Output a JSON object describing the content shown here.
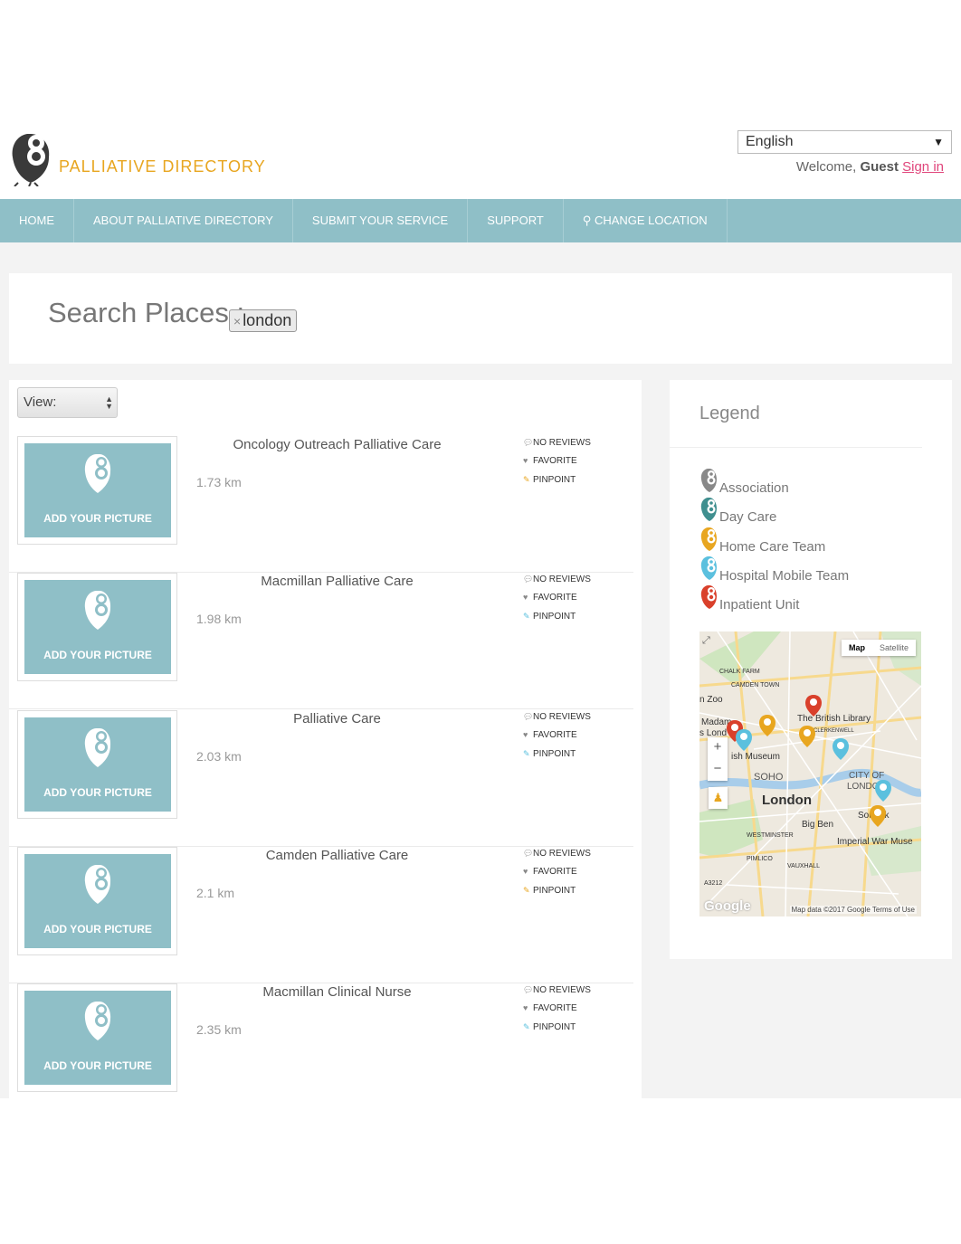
{
  "header": {
    "logo_text": "PALLIATIVE DIRECTORY",
    "language": "English",
    "welcome_prefix": "Welcome,",
    "welcome_user": "Guest",
    "sign_in": "Sign in"
  },
  "nav": {
    "items": [
      "HOME",
      "ABOUT PALLIATIVE DIRECTORY",
      "SUBMIT YOUR SERVICE",
      "SUPPORT",
      "CHANGE LOCATION"
    ]
  },
  "search": {
    "title": "Search Places :",
    "tag_remove": "×",
    "tag": "london"
  },
  "results": {
    "view_label": "View:",
    "add_picture": "ADD YOUR PICTURE",
    "meta_reviews": "NO REVIEWS",
    "meta_favorite": "FAVORITE",
    "meta_pinpoint": "PINPOINT",
    "items": [
      {
        "title": "Oncology Outreach Palliative Care",
        "distance": "1.73 km",
        "pin_color": "#e8a620"
      },
      {
        "title": "Macmillan Palliative Care",
        "distance": "1.98 km",
        "pin_color": "#5bc0de"
      },
      {
        "title": "Palliative Care",
        "distance": "2.03 km",
        "pin_color": "#5bc0de"
      },
      {
        "title": "Camden Palliative Care",
        "distance": "2.1 km",
        "pin_color": "#e8a620"
      },
      {
        "title": "Macmillan Clinical Nurse",
        "distance": "2.35 km",
        "pin_color": "#5bc0de"
      }
    ]
  },
  "legend": {
    "title": "Legend",
    "items": [
      {
        "label": "Association",
        "color": "#888888"
      },
      {
        "label": "Day Care",
        "color": "#3f8f8f"
      },
      {
        "label": "Home Care Team",
        "color": "#e8a620"
      },
      {
        "label": "Hospital Mobile Team",
        "color": "#5bc0de"
      },
      {
        "label": "Inpatient Unit",
        "color": "#d9402b"
      }
    ]
  },
  "map": {
    "type_map": "Map",
    "type_satellite": "Satellite",
    "zoom_in": "+",
    "zoom_out": "−",
    "labels": {
      "chalk_farm": "CHALK FARM",
      "camden_town": "CAMDEN TOWN",
      "zoo": "n Zoo",
      "madam": "Madam",
      "s_lond": "s Lond",
      "british_library": "The British Library",
      "clerkenwell": "CLERKENWELL",
      "museum": "ish Museum",
      "soho": "SOHO",
      "city_of": "CITY OF",
      "london_city": "LONDON",
      "london": "London",
      "big_ben": "Big Ben",
      "southwark": "Sou  ark",
      "westminster": "WESTMINSTER",
      "imperial": "Imperial War Muse",
      "pimlico": "PIMLICO",
      "vauxhall": "VAUXHALL",
      "a3212": "A3212"
    },
    "google": "Google",
    "map_data": "Map data ©2017 Google   Terms of Use"
  }
}
